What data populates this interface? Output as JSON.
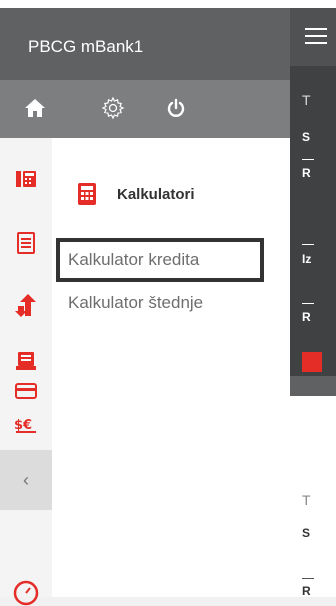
{
  "drawer": {
    "app_title": "PBCG mBank1",
    "menu_header": "Kalkulatori",
    "menu_items": [
      "Kalkulator kredita",
      "Kalkulator štednje"
    ]
  },
  "background_app": {
    "panel1_letters": [
      "T",
      "S",
      "R",
      "Iz",
      "R"
    ],
    "panel2_letters": [
      "T",
      "S",
      "R"
    ]
  },
  "colors": {
    "header_bg": "#5f6163",
    "icon_bar_bg": "#7c7e80",
    "accent_red": "#e52d27"
  }
}
